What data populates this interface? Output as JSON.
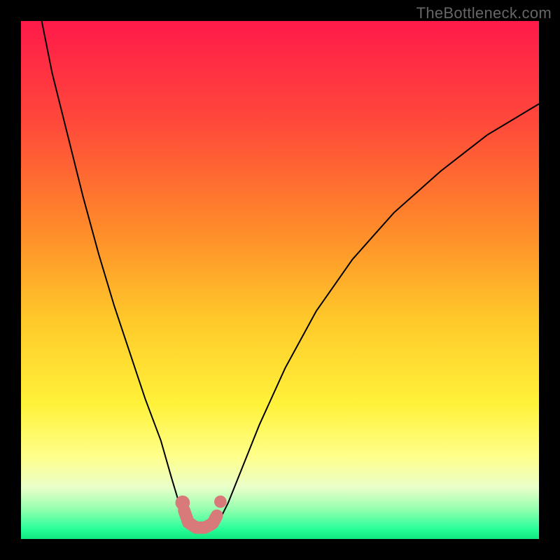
{
  "watermark": "TheBottleneck.com",
  "chart_data": {
    "type": "line",
    "title": "",
    "xlabel": "",
    "ylabel": "",
    "xlim": [
      0,
      100
    ],
    "ylim": [
      0,
      100
    ],
    "background_gradient": {
      "stops": [
        {
          "offset": 0.0,
          "color": "#ff1a4a"
        },
        {
          "offset": 0.2,
          "color": "#ff4a3a"
        },
        {
          "offset": 0.4,
          "color": "#ff8a2a"
        },
        {
          "offset": 0.58,
          "color": "#ffca2a"
        },
        {
          "offset": 0.74,
          "color": "#fff23a"
        },
        {
          "offset": 0.84,
          "color": "#ffff8a"
        },
        {
          "offset": 0.9,
          "color": "#eaffca"
        },
        {
          "offset": 0.94,
          "color": "#9affb0"
        },
        {
          "offset": 0.98,
          "color": "#2aff9a"
        },
        {
          "offset": 1.0,
          "color": "#10e880"
        }
      ]
    },
    "series": [
      {
        "name": "bottleneck-curve",
        "stroke": "#000000",
        "stroke_width": 2,
        "points": [
          {
            "x": 4,
            "y": 100
          },
          {
            "x": 6,
            "y": 90
          },
          {
            "x": 9,
            "y": 78
          },
          {
            "x": 12,
            "y": 66
          },
          {
            "x": 15,
            "y": 55
          },
          {
            "x": 18,
            "y": 45
          },
          {
            "x": 21,
            "y": 36
          },
          {
            "x": 24,
            "y": 27
          },
          {
            "x": 27,
            "y": 19
          },
          {
            "x": 29,
            "y": 12
          },
          {
            "x": 30.5,
            "y": 7
          },
          {
            "x": 31.5,
            "y": 4
          },
          {
            "x": 33,
            "y": 2.2
          },
          {
            "x": 35,
            "y": 1.8
          },
          {
            "x": 37,
            "y": 2.2
          },
          {
            "x": 38.5,
            "y": 4
          },
          {
            "x": 40,
            "y": 7
          },
          {
            "x": 42,
            "y": 12
          },
          {
            "x": 46,
            "y": 22
          },
          {
            "x": 51,
            "y": 33
          },
          {
            "x": 57,
            "y": 44
          },
          {
            "x": 64,
            "y": 54
          },
          {
            "x": 72,
            "y": 63
          },
          {
            "x": 81,
            "y": 71
          },
          {
            "x": 90,
            "y": 78
          },
          {
            "x": 100,
            "y": 84
          }
        ]
      }
    ],
    "highlights": [
      {
        "type": "dot",
        "x": 31.2,
        "y": 7.0,
        "r": 1.4,
        "color": "#d87a7a"
      },
      {
        "type": "path",
        "color": "#d87a7a",
        "width": 2.4,
        "points": [
          {
            "x": 31.5,
            "y": 5.5
          },
          {
            "x": 32.3,
            "y": 3.2
          },
          {
            "x": 33.8,
            "y": 2.2
          },
          {
            "x": 35.5,
            "y": 2.2
          },
          {
            "x": 37.0,
            "y": 3.0
          },
          {
            "x": 37.8,
            "y": 4.5
          }
        ]
      },
      {
        "type": "dot",
        "x": 38.5,
        "y": 7.2,
        "r": 1.2,
        "color": "#d87a7a"
      }
    ]
  }
}
